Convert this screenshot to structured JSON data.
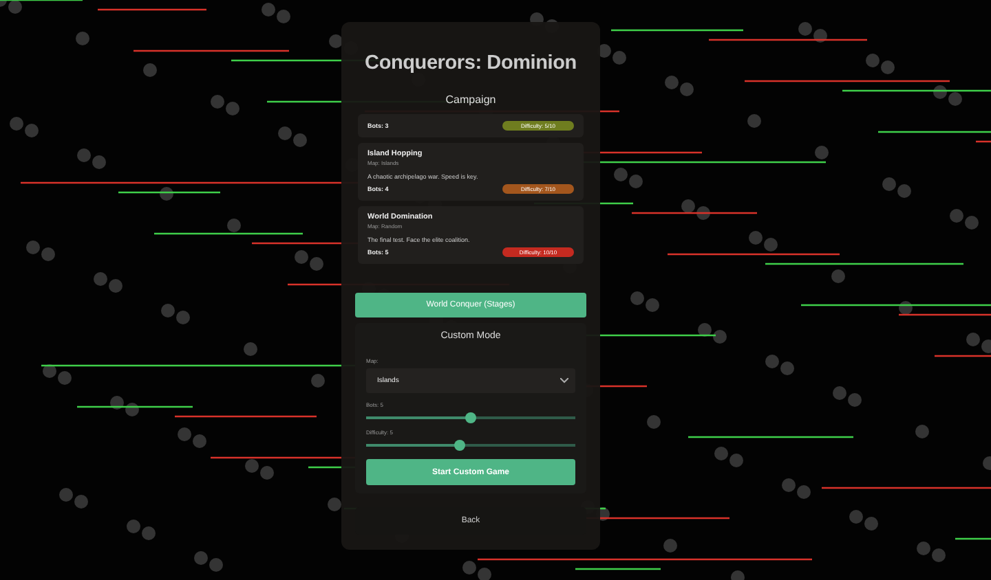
{
  "title": "Conquerors: Dominion",
  "campaign": {
    "heading": "Campaign",
    "levels": [
      {
        "bots": "Bots: 3",
        "difficulty": "Difficulty: 5/10",
        "color": "#6f7d1f"
      },
      {
        "name": "Island Hopping",
        "map": "Map: Islands",
        "description": "A chaotic archipelago war. Speed is key.",
        "bots": "Bots: 4",
        "difficulty": "Difficulty: 7/10",
        "color": "#a3561d"
      },
      {
        "name": "World Domination",
        "map": "Map: Random",
        "description": "The final test. Face the elite coalition.",
        "bots": "Bots: 5",
        "difficulty": "Difficulty: 10/10",
        "color": "#c42a20"
      }
    ]
  },
  "world_conquer_button": "World Conquer (Stages)",
  "custom": {
    "heading": "Custom Mode",
    "map_label": "Map:",
    "map_value": "Islands",
    "sliders": [
      {
        "label": "Bots: 5",
        "level": 0.5
      },
      {
        "label": "Difficulty: 5",
        "level": 0.45
      }
    ],
    "start_button": "Start Custom Game"
  },
  "back_button": "Back"
}
